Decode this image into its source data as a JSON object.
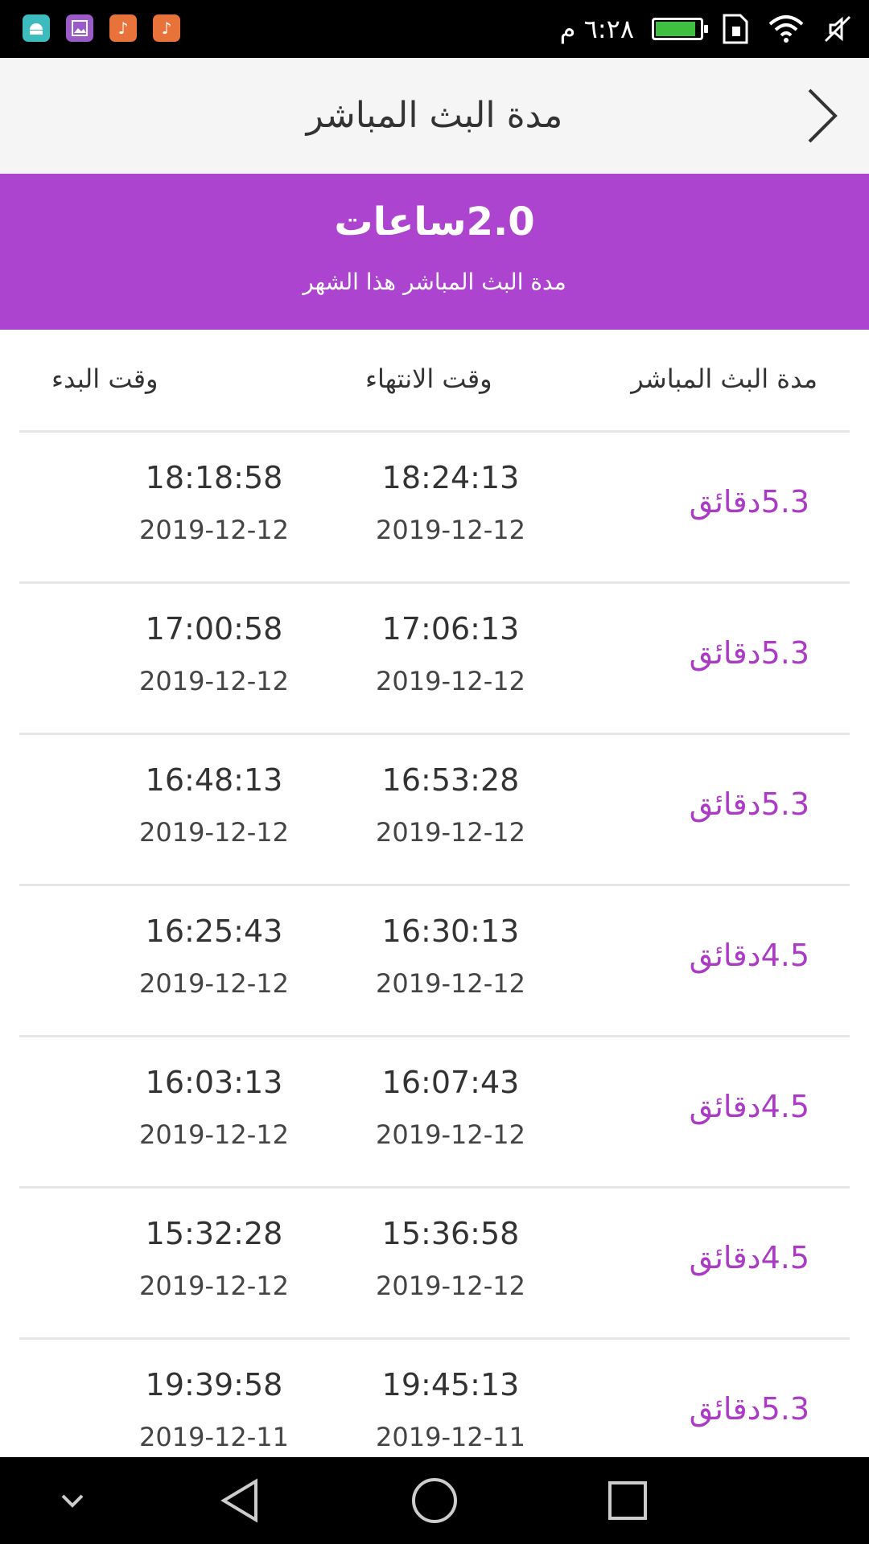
{
  "status_bar": {
    "time": "٦:٢٨ م",
    "apps": [
      {
        "icon": "android-icon",
        "color": "#3dbcc0"
      },
      {
        "icon": "gallery-icon",
        "color": "#9b5ac8"
      },
      {
        "icon": "music-icon",
        "color": "#e8733a"
      },
      {
        "icon": "music-icon",
        "color": "#e8733a"
      }
    ],
    "icons": [
      "mute-icon",
      "wifi-icon",
      "sim-icon",
      "battery-icon"
    ],
    "battery_level": 0.9
  },
  "header": {
    "title": "مدة البث المباشر",
    "back_icon": "chevron-right-icon"
  },
  "summary": {
    "value": "2.0ساعات",
    "label": "مدة البث المباشر هذا الشهر",
    "accent_color": "#ad44cf"
  },
  "columns": {
    "duration": "مدة البث المباشر",
    "end": "وقت الانتهاء",
    "start": "وقت البدء"
  },
  "rows": [
    {
      "duration": "5.3دقائق",
      "end_time": "18:24:13",
      "end_date": "2019-12-12",
      "start_time": "18:18:58",
      "start_date": "2019-12-12"
    },
    {
      "duration": "5.3دقائق",
      "end_time": "17:06:13",
      "end_date": "2019-12-12",
      "start_time": "17:00:58",
      "start_date": "2019-12-12"
    },
    {
      "duration": "5.3دقائق",
      "end_time": "16:53:28",
      "end_date": "2019-12-12",
      "start_time": "16:48:13",
      "start_date": "2019-12-12"
    },
    {
      "duration": "4.5دقائق",
      "end_time": "16:30:13",
      "end_date": "2019-12-12",
      "start_time": "16:25:43",
      "start_date": "2019-12-12"
    },
    {
      "duration": "4.5دقائق",
      "end_time": "16:07:43",
      "end_date": "2019-12-12",
      "start_time": "16:03:13",
      "start_date": "2019-12-12"
    },
    {
      "duration": "4.5دقائق",
      "end_time": "15:36:58",
      "end_date": "2019-12-12",
      "start_time": "15:32:28",
      "start_date": "2019-12-12"
    },
    {
      "duration": "5.3دقائق",
      "end_time": "19:45:13",
      "end_date": "2019-12-11",
      "start_time": "19:39:58",
      "start_date": "2019-12-11"
    }
  ],
  "nav_bar": [
    "collapse-icon",
    "back-triangle-icon",
    "home-circle-icon",
    "recents-square-icon"
  ]
}
